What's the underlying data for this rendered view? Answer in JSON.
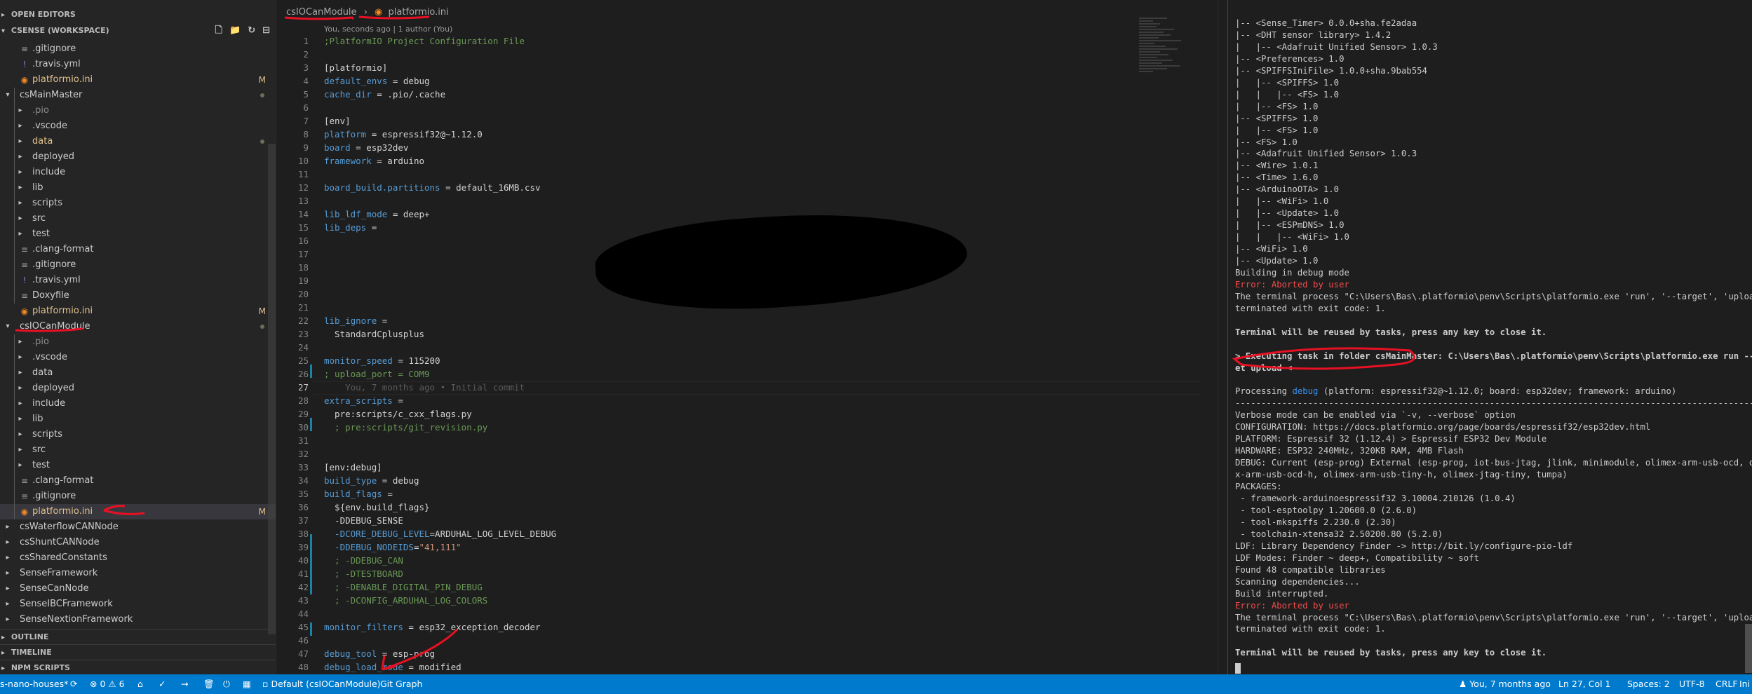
{
  "sidebar": {
    "open_editors": "OPEN EDITORS",
    "workspace": "CSENSE (WORKSPACE)",
    "outline": "OUTLINE",
    "timeline": "TIMELINE",
    "npm_scripts": "NPM SCRIPTS",
    "actions": [
      "new-file",
      "new-folder",
      "refresh",
      "collapse-all"
    ],
    "rows": [
      {
        "label": ".gitignore",
        "type": "file",
        "depth": 1
      },
      {
        "label": ".travis.yml",
        "type": "yaml",
        "depth": 1
      },
      {
        "label": "platformio.ini",
        "type": "pio",
        "depth": 1,
        "badge": "M"
      },
      {
        "label": "csMainMaster",
        "type": "folder-open",
        "depth": 0,
        "dot": true
      },
      {
        "label": ".pio",
        "type": "folder",
        "depth": 1,
        "dim": true
      },
      {
        "label": ".vscode",
        "type": "folder",
        "depth": 1
      },
      {
        "label": "data",
        "type": "folder",
        "depth": 1,
        "modified": true,
        "dot": true
      },
      {
        "label": "deployed",
        "type": "folder",
        "depth": 1
      },
      {
        "label": "include",
        "type": "folder",
        "depth": 1
      },
      {
        "label": "lib",
        "type": "folder",
        "depth": 1
      },
      {
        "label": "scripts",
        "type": "folder",
        "depth": 1
      },
      {
        "label": "src",
        "type": "folder",
        "depth": 1
      },
      {
        "label": "test",
        "type": "folder",
        "depth": 1
      },
      {
        "label": ".clang-format",
        "type": "file",
        "depth": 1
      },
      {
        "label": ".gitignore",
        "type": "file",
        "depth": 1
      },
      {
        "label": ".travis.yml",
        "type": "yaml",
        "depth": 1
      },
      {
        "label": "Doxyfile",
        "type": "file",
        "depth": 1
      },
      {
        "label": "platformio.ini",
        "type": "pio",
        "depth": 1,
        "badge": "M"
      },
      {
        "label": "csIOCanModule",
        "type": "folder-open",
        "depth": 0,
        "dot": true
      },
      {
        "label": ".pio",
        "type": "folder",
        "depth": 1,
        "dim": true
      },
      {
        "label": ".vscode",
        "type": "folder",
        "depth": 1
      },
      {
        "label": "data",
        "type": "folder",
        "depth": 1
      },
      {
        "label": "deployed",
        "type": "folder",
        "depth": 1
      },
      {
        "label": "include",
        "type": "folder",
        "depth": 1
      },
      {
        "label": "lib",
        "type": "folder",
        "depth": 1
      },
      {
        "label": "scripts",
        "type": "folder",
        "depth": 1
      },
      {
        "label": "src",
        "type": "folder",
        "depth": 1
      },
      {
        "label": "test",
        "type": "folder",
        "depth": 1
      },
      {
        "label": ".clang-format",
        "type": "file",
        "depth": 1
      },
      {
        "label": ".gitignore",
        "type": "file",
        "depth": 1
      },
      {
        "label": "platformio.ini",
        "type": "pio",
        "depth": 1,
        "badge": "M",
        "selected": true
      },
      {
        "label": "csWaterflowCANNode",
        "type": "folder",
        "depth": 0
      },
      {
        "label": "csShuntCANNode",
        "type": "folder",
        "depth": 0
      },
      {
        "label": "csSharedConstants",
        "type": "folder",
        "depth": 0
      },
      {
        "label": "SenseFramework",
        "type": "folder",
        "depth": 0
      },
      {
        "label": "SenseCanNode",
        "type": "folder",
        "depth": 0
      },
      {
        "label": "SenseIBCFramework",
        "type": "folder",
        "depth": 0
      },
      {
        "label": "SenseNextionFramework",
        "type": "folder",
        "depth": 0
      }
    ]
  },
  "editor": {
    "breadcrumb": [
      "csIOCanModule",
      "platformio.ini"
    ],
    "codelens": "You, seconds ago | 1 author (You)",
    "current_line": 27,
    "lines": [
      {
        "n": 1,
        "segs": [
          {
            "t": ";PlatformIO Project Configuration File",
            "c": "com"
          }
        ]
      },
      {
        "n": 2,
        "segs": []
      },
      {
        "n": 3,
        "segs": [
          {
            "t": "[platformio]",
            "c": "sec"
          }
        ]
      },
      {
        "n": 4,
        "segs": [
          {
            "t": "default_envs",
            "c": "key"
          },
          {
            "t": " = debug",
            "c": ""
          }
        ]
      },
      {
        "n": 5,
        "segs": [
          {
            "t": "cache_dir",
            "c": "key"
          },
          {
            "t": " = .pio/.cache",
            "c": ""
          }
        ]
      },
      {
        "n": 6,
        "segs": []
      },
      {
        "n": 7,
        "segs": [
          {
            "t": "[env]",
            "c": "sec"
          }
        ]
      },
      {
        "n": 8,
        "segs": [
          {
            "t": "platform",
            "c": "key"
          },
          {
            "t": " = espressif32@~1.12.0",
            "c": ""
          }
        ]
      },
      {
        "n": 9,
        "segs": [
          {
            "t": "board",
            "c": "key"
          },
          {
            "t": " = esp32dev",
            "c": ""
          }
        ]
      },
      {
        "n": 10,
        "segs": [
          {
            "t": "framework",
            "c": "key"
          },
          {
            "t": " = arduino",
            "c": ""
          }
        ]
      },
      {
        "n": 11,
        "segs": []
      },
      {
        "n": 12,
        "segs": [
          {
            "t": "board_build.partitions",
            "c": "key"
          },
          {
            "t": " = default_16MB.csv",
            "c": ""
          }
        ]
      },
      {
        "n": 13,
        "segs": []
      },
      {
        "n": 14,
        "segs": [
          {
            "t": "lib_ldf_mode",
            "c": "key"
          },
          {
            "t": " = deep+",
            "c": ""
          }
        ]
      },
      {
        "n": 15,
        "segs": [
          {
            "t": "lib_deps",
            "c": "key"
          },
          {
            "t": " =",
            "c": ""
          }
        ]
      },
      {
        "n": 16,
        "segs": []
      },
      {
        "n": 17,
        "segs": []
      },
      {
        "n": 18,
        "segs": []
      },
      {
        "n": 19,
        "segs": []
      },
      {
        "n": 20,
        "segs": []
      },
      {
        "n": 21,
        "segs": []
      },
      {
        "n": 22,
        "segs": [
          {
            "t": "lib_ignore",
            "c": "key"
          },
          {
            "t": " =",
            "c": ""
          }
        ]
      },
      {
        "n": 23,
        "segs": [
          {
            "t": "  StandardCplusplus",
            "c": ""
          }
        ]
      },
      {
        "n": 24,
        "segs": []
      },
      {
        "n": 25,
        "segs": [
          {
            "t": "monitor_speed",
            "c": "key"
          },
          {
            "t": " = 115200",
            "c": ""
          }
        ]
      },
      {
        "n": 26,
        "segs": [
          {
            "t": "; upload_port = COM9",
            "c": "com"
          }
        ]
      },
      {
        "n": 27,
        "segs": [
          {
            "t": "    You, 7 months ago • Initial commit",
            "c": "blame"
          }
        ]
      },
      {
        "n": 28,
        "segs": [
          {
            "t": "extra_scripts",
            "c": "key"
          },
          {
            "t": " =",
            "c": ""
          }
        ]
      },
      {
        "n": 29,
        "segs": [
          {
            "t": "  pre:scripts/c_cxx_flags.py",
            "c": ""
          }
        ]
      },
      {
        "n": 30,
        "segs": [
          {
            "t": "  ; pre:scripts/git_revision.py",
            "c": "com"
          }
        ]
      },
      {
        "n": 31,
        "segs": []
      },
      {
        "n": 32,
        "segs": []
      },
      {
        "n": 33,
        "segs": [
          {
            "t": "[env:debug]",
            "c": "sec"
          }
        ]
      },
      {
        "n": 34,
        "segs": [
          {
            "t": "build_type",
            "c": "key"
          },
          {
            "t": " = debug",
            "c": ""
          }
        ]
      },
      {
        "n": 35,
        "segs": [
          {
            "t": "build_flags",
            "c": "key"
          },
          {
            "t": " =",
            "c": ""
          }
        ]
      },
      {
        "n": 36,
        "segs": [
          {
            "t": "  ${env.build_flags}",
            "c": ""
          }
        ]
      },
      {
        "n": 37,
        "segs": [
          {
            "t": "  -DDEBUG_SENSE",
            "c": ""
          }
        ]
      },
      {
        "n": 38,
        "segs": [
          {
            "t": "  -DCORE_DEBUG_LEVEL",
            "c": "key"
          },
          {
            "t": "=ARDUHAL_LOG_LEVEL_DEBUG",
            "c": ""
          }
        ]
      },
      {
        "n": 39,
        "segs": [
          {
            "t": "  -DDEBUG_NODEIDS",
            "c": "key"
          },
          {
            "t": "=",
            "c": ""
          },
          {
            "t": "\"41,111\"",
            "c": "str"
          }
        ]
      },
      {
        "n": 40,
        "segs": [
          {
            "t": "  ; -DDEBUG_CAN",
            "c": "com"
          }
        ]
      },
      {
        "n": 41,
        "segs": [
          {
            "t": "  ; -DTESTBOARD",
            "c": "com"
          }
        ]
      },
      {
        "n": 42,
        "segs": [
          {
            "t": "  ; -DENABLE_DIGITAL_PIN_DEBUG",
            "c": "com"
          }
        ]
      },
      {
        "n": 43,
        "segs": [
          {
            "t": "  ; -DCONFIG_ARDUHAL_LOG_COLORS",
            "c": "com"
          }
        ]
      },
      {
        "n": 44,
        "segs": []
      },
      {
        "n": 45,
        "segs": [
          {
            "t": "monitor_filters",
            "c": "key"
          },
          {
            "t": " = esp32_exception_decoder",
            "c": ""
          }
        ]
      },
      {
        "n": 46,
        "segs": []
      },
      {
        "n": 47,
        "segs": [
          {
            "t": "debug_tool",
            "c": "key"
          },
          {
            "t": " = esp-prog",
            "c": ""
          }
        ]
      },
      {
        "n": 48,
        "segs": [
          {
            "t": "debug_load_mode",
            "c": "key"
          },
          {
            "t": " = modified",
            "c": ""
          }
        ]
      }
    ]
  },
  "terminal": {
    "lines": [
      {
        "t": "|-- <Sense_Timer> 0.0.0+sha.fe2adaa"
      },
      {
        "t": "|-- <DHT sensor library> 1.4.2"
      },
      {
        "t": "|   |-- <Adafruit Unified Sensor> 1.0.3"
      },
      {
        "t": "|-- <Preferences> 1.0"
      },
      {
        "t": "|-- <SPIFFSIniFile> 1.0.0+sha.9bab554"
      },
      {
        "t": "|   |-- <SPIFFS> 1.0"
      },
      {
        "t": "|   |   |-- <FS> 1.0"
      },
      {
        "t": "|   |-- <FS> 1.0"
      },
      {
        "t": "|-- <SPIFFS> 1.0"
      },
      {
        "t": "|   |-- <FS> 1.0"
      },
      {
        "t": "|-- <FS> 1.0"
      },
      {
        "t": "|-- <Adafruit Unified Sensor> 1.0.3"
      },
      {
        "t": "|-- <Wire> 1.0.1"
      },
      {
        "t": "|-- <Time> 1.6.0"
      },
      {
        "t": "|-- <ArduinoOTA> 1.0"
      },
      {
        "t": "|   |-- <WiFi> 1.0"
      },
      {
        "t": "|   |-- <Update> 1.0"
      },
      {
        "t": "|   |-- <ESPmDNS> 1.0"
      },
      {
        "t": "|   |   |-- <WiFi> 1.0"
      },
      {
        "t": "|-- <WiFi> 1.0"
      },
      {
        "t": "|-- <Update> 1.0"
      },
      {
        "t": "Building in debug mode"
      },
      {
        "t": "Error: Aborted by user",
        "s": "err"
      },
      {
        "t": "The terminal process \"C:\\Users\\Bas\\.platformio\\penv\\Scripts\\platformio.exe 'run', '--target', 'upload'\""
      },
      {
        "t": "terminated with exit code: 1."
      },
      {
        "t": ""
      },
      {
        "t": "Terminal will be reused by tasks, press any key to close it.",
        "s": "bold"
      },
      {
        "t": ""
      },
      {
        "t": "> Executing task in folder csMainMaster: C:\\Users\\Bas\\.platformio\\penv\\Scripts\\platformio.exe run --targ",
        "s": "bold"
      },
      {
        "t": "et upload <",
        "s": "bold"
      },
      {
        "t": ""
      },
      {
        "t": "Processing debug (platform: espressif32@~1.12.0; board: esp32dev; framework: arduino)",
        "s": "proc"
      },
      {
        "t": "------------------------------------------------------------------------------------------------------------"
      },
      {
        "t": "Verbose mode can be enabled via `-v, --verbose` option"
      },
      {
        "t": "CONFIGURATION: https://docs.platformio.org/page/boards/espressif32/esp32dev.html"
      },
      {
        "t": "PLATFORM: Espressif 32 (1.12.4) > Espressif ESP32 Dev Module"
      },
      {
        "t": "HARDWARE: ESP32 240MHz, 320KB RAM, 4MB Flash"
      },
      {
        "t": "DEBUG: Current (esp-prog) External (esp-prog, iot-bus-jtag, jlink, minimodule, olimex-arm-usb-ocd, olime"
      },
      {
        "t": "x-arm-usb-ocd-h, olimex-arm-usb-tiny-h, olimex-jtag-tiny, tumpa)"
      },
      {
        "t": "PACKAGES:"
      },
      {
        "t": " - framework-arduinoespressif32 3.10004.210126 (1.0.4)"
      },
      {
        "t": " - tool-esptoolpy 1.20600.0 (2.6.0)"
      },
      {
        "t": " - tool-mkspiffs 2.230.0 (2.30)"
      },
      {
        "t": " - toolchain-xtensa32 2.50200.80 (5.2.0)"
      },
      {
        "t": "LDF: Library Dependency Finder -> http://bit.ly/configure-pio-ldf"
      },
      {
        "t": "LDF Modes: Finder ~ deep+, Compatibility ~ soft"
      },
      {
        "t": "Found 48 compatible libraries"
      },
      {
        "t": "Scanning dependencies..."
      },
      {
        "t": "Build interrupted."
      },
      {
        "t": "Error: Aborted by user",
        "s": "err"
      },
      {
        "t": "The terminal process \"C:\\Users\\Bas\\.platformio\\penv\\Scripts\\platformio.exe 'run', '--target', 'upload'\""
      },
      {
        "t": "terminated with exit code: 1."
      },
      {
        "t": ""
      },
      {
        "t": "Terminal will be reused by tasks, press any key to close it.",
        "s": "bold"
      }
    ]
  },
  "statusbar": {
    "branch": "s-nano-houses*",
    "sync_icon": "sync-icon",
    "errors": "0",
    "warnings": "6",
    "env": "Default (csIOCanModule)",
    "git_graph": "Git Graph",
    "blame": "You, 7 months ago",
    "position": "Ln 27, Col 1",
    "spaces": "Spaces: 2",
    "encoding": "UTF-8",
    "eol": "CRLF",
    "language": "Ini"
  },
  "colors": {
    "statusbar": "#007acc",
    "sidebar": "#252526",
    "editor": "#1e1e1e",
    "annotation_red": "#e81123",
    "modified": "#e2c08d",
    "error": "#f14c4c"
  }
}
